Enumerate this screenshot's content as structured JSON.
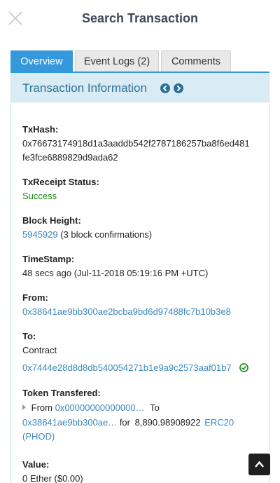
{
  "header": {
    "title": "Search Transaction",
    "close_icon": "close-icon"
  },
  "tabs": [
    {
      "label": "Overview",
      "active": true
    },
    {
      "label": "Event Logs (2)",
      "active": false
    },
    {
      "label": "Comments",
      "active": false
    }
  ],
  "panel": {
    "title": "Transaction Information",
    "prev_icon": "chevron-left-circle-icon",
    "next_icon": "chevron-right-circle-icon"
  },
  "fields": {
    "txhash": {
      "label": "TxHash:",
      "value_line1": "0x76673174918d1a3aaddb542f2787186257ba8f6ed481",
      "value_line2": "fe3fce6889829d9ada62"
    },
    "receipt": {
      "label": "TxReceipt Status:",
      "value": "Success"
    },
    "block": {
      "label": "Block Height:",
      "height": "5945929",
      "confirmations": "(3 block confirmations)"
    },
    "timestamp": {
      "label": "TimeStamp:",
      "value": "48 secs ago (Jul-11-2018 05:19:16 PM +UTC)"
    },
    "from": {
      "label": "From:",
      "value": "0x38641ae9bb300ae2bcba9bd6d97488fc7b10b3e8"
    },
    "to": {
      "label": "To:",
      "type": "Contract",
      "address": "0x7444e28d8d8db540054271b1e9a9c2573aaf01b7"
    },
    "token": {
      "label": "Token Transfered:",
      "from_word": "From",
      "from_addr": "0x00000000000000…",
      "to_word": "To",
      "to_addr": "0x38641ae9bb300ae…",
      "for_word": "for",
      "amount": "8,890.98908922",
      "token_name": "ERC20",
      "token_symbol": "(PHOD)"
    },
    "value": {
      "label": "Value:",
      "amount": "0 Ether ($0.00)"
    }
  },
  "colors": {
    "accent": "#3598dc",
    "link": "#3a87bd",
    "success": "#1a8a1a",
    "panel_header_bg": "#d9ecf6"
  },
  "scroll_top_icon": "chevron-up-icon"
}
